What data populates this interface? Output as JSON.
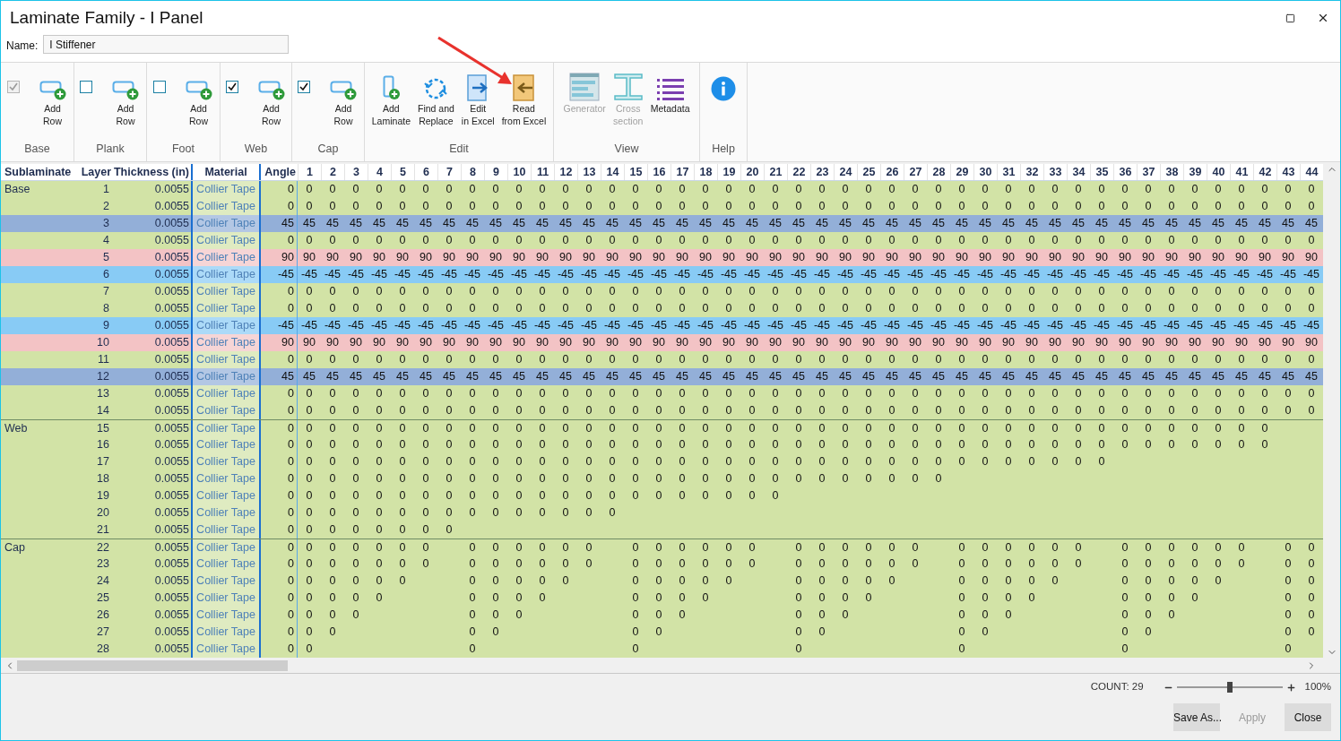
{
  "window": {
    "title": "Laminate Family - I Panel"
  },
  "name_field": {
    "label": "Name:",
    "value": "I Stiffener"
  },
  "ribbon": {
    "groups": [
      {
        "label": "Base",
        "items": [
          {
            "kind": "checkbox",
            "checked": true,
            "disabled": true
          },
          {
            "kind": "add-row",
            "lines": [
              "Add",
              "Row"
            ],
            "disabled": false
          }
        ]
      },
      {
        "label": "Plank",
        "items": [
          {
            "kind": "checkbox",
            "checked": false,
            "disabled": false
          },
          {
            "kind": "add-row",
            "lines": [
              "Add",
              "Row"
            ],
            "disabled": false
          }
        ]
      },
      {
        "label": "Foot",
        "items": [
          {
            "kind": "checkbox",
            "checked": false,
            "disabled": false
          },
          {
            "kind": "add-row",
            "lines": [
              "Add",
              "Row"
            ],
            "disabled": false
          }
        ]
      },
      {
        "label": "Web",
        "items": [
          {
            "kind": "checkbox",
            "checked": true,
            "disabled": false
          },
          {
            "kind": "add-row",
            "lines": [
              "Add",
              "Row"
            ],
            "disabled": false
          }
        ]
      },
      {
        "label": "Cap",
        "items": [
          {
            "kind": "checkbox",
            "checked": true,
            "disabled": false
          },
          {
            "kind": "add-row",
            "lines": [
              "Add",
              "Row"
            ],
            "disabled": false
          }
        ]
      },
      {
        "label": "Edit",
        "items": [
          {
            "kind": "add-laminate",
            "lines": [
              "Add",
              "Laminate"
            ],
            "disabled": false
          },
          {
            "kind": "find-replace",
            "lines": [
              "Find and",
              "Replace"
            ],
            "disabled": false
          },
          {
            "kind": "edit-excel",
            "lines": [
              "Edit",
              "in Excel"
            ],
            "disabled": false
          },
          {
            "kind": "read-excel",
            "lines": [
              "Read",
              "from Excel"
            ],
            "disabled": false
          }
        ]
      },
      {
        "label": "View",
        "items": [
          {
            "kind": "generator",
            "lines": [
              "Generator"
            ],
            "disabled": true
          },
          {
            "kind": "cross-section",
            "lines": [
              "Cross",
              "section"
            ],
            "disabled": true
          },
          {
            "kind": "metadata",
            "lines": [
              "Metadata"
            ],
            "disabled": false
          }
        ]
      },
      {
        "label": "Help",
        "items": [
          {
            "kind": "help"
          }
        ]
      }
    ]
  },
  "table": {
    "columns": [
      {
        "label": "Sublaminate",
        "selected": false
      },
      {
        "label": "Layer",
        "selected": false
      },
      {
        "label": "Thickness (in)",
        "selected": false
      },
      {
        "label": "Material",
        "selected": true
      },
      {
        "label": "Angle",
        "selected": false
      },
      {
        "label": "1",
        "selected": false
      },
      {
        "label": "2",
        "selected": false
      },
      {
        "label": "3",
        "selected": false
      },
      {
        "label": "4",
        "selected": false
      },
      {
        "label": "5",
        "selected": false
      },
      {
        "label": "6",
        "selected": false
      },
      {
        "label": "7",
        "selected": false
      },
      {
        "label": "8",
        "selected": false
      },
      {
        "label": "9",
        "selected": false
      },
      {
        "label": "10",
        "selected": false
      },
      {
        "label": "11",
        "selected": false
      },
      {
        "label": "12",
        "selected": false
      },
      {
        "label": "13",
        "selected": false
      },
      {
        "label": "14",
        "selected": false
      },
      {
        "label": "15",
        "selected": false
      },
      {
        "label": "16",
        "selected": false
      },
      {
        "label": "17",
        "selected": false
      },
      {
        "label": "18",
        "selected": false
      },
      {
        "label": "19",
        "selected": false
      },
      {
        "label": "20",
        "selected": false
      },
      {
        "label": "21",
        "selected": false
      },
      {
        "label": "22",
        "selected": false
      },
      {
        "label": "23",
        "selected": false
      },
      {
        "label": "24",
        "selected": false
      },
      {
        "label": "25",
        "selected": false
      },
      {
        "label": "26",
        "selected": false
      },
      {
        "label": "27",
        "selected": false
      },
      {
        "label": "28",
        "selected": false
      },
      {
        "label": "29",
        "selected": false
      },
      {
        "label": "30",
        "selected": false
      },
      {
        "label": "31",
        "selected": false
      },
      {
        "label": "32",
        "selected": false
      },
      {
        "label": "33",
        "selected": false
      },
      {
        "label": "34",
        "selected": false
      },
      {
        "label": "35",
        "selected": false
      },
      {
        "label": "36",
        "selected": false
      },
      {
        "label": "37",
        "selected": false
      },
      {
        "label": "38",
        "selected": false
      },
      {
        "label": "39",
        "selected": false
      },
      {
        "label": "40",
        "selected": false
      },
      {
        "label": "41",
        "selected": false
      },
      {
        "label": "42",
        "selected": false
      },
      {
        "label": "43",
        "selected": false
      },
      {
        "label": "44",
        "selected": false
      }
    ],
    "sublaminates": [
      {
        "name": "Base",
        "layers": [
          {
            "layer": "1",
            "thickness": "0.0055",
            "material": "Collier Tape",
            "angle": "0",
            "color": "#d2e3a6",
            "cells": [
              "0",
              "0",
              "0",
              "0",
              "0",
              "0",
              "0",
              "0",
              "0",
              "0",
              "0",
              "0",
              "0",
              "0",
              "0",
              "0",
              "0",
              "0",
              "0",
              "0",
              "0",
              "0",
              "0",
              "0",
              "0",
              "0",
              "0",
              "0",
              "0",
              "0",
              "0",
              "0",
              "0",
              "0",
              "0",
              "0",
              "0",
              "0",
              "0",
              "0",
              "0",
              "0",
              "0",
              "0"
            ]
          },
          {
            "layer": "2",
            "thickness": "0.0055",
            "material": "Collier Tape",
            "angle": "0",
            "color": "#d2e3a6",
            "cells": [
              "0",
              "0",
              "0",
              "0",
              "0",
              "0",
              "0",
              "0",
              "0",
              "0",
              "0",
              "0",
              "0",
              "0",
              "0",
              "0",
              "0",
              "0",
              "0",
              "0",
              "0",
              "0",
              "0",
              "0",
              "0",
              "0",
              "0",
              "0",
              "0",
              "0",
              "0",
              "0",
              "0",
              "0",
              "0",
              "0",
              "0",
              "0",
              "0",
              "0",
              "0",
              "0",
              "0",
              "0"
            ]
          },
          {
            "layer": "3",
            "thickness": "0.0055",
            "material": "Collier Tape",
            "angle": "45",
            "color": "#93afd8",
            "cells": [
              "45",
              "45",
              "45",
              "45",
              "45",
              "45",
              "45",
              "45",
              "45",
              "45",
              "45",
              "45",
              "45",
              "45",
              "45",
              "45",
              "45",
              "45",
              "45",
              "45",
              "45",
              "45",
              "45",
              "45",
              "45",
              "45",
              "45",
              "45",
              "45",
              "45",
              "45",
              "45",
              "45",
              "45",
              "45",
              "45",
              "45",
              "45",
              "45",
              "45",
              "45",
              "45",
              "45",
              "45"
            ]
          },
          {
            "layer": "4",
            "thickness": "0.0055",
            "material": "Collier Tape",
            "angle": "0",
            "color": "#d2e3a6",
            "cells": [
              "0",
              "0",
              "0",
              "0",
              "0",
              "0",
              "0",
              "0",
              "0",
              "0",
              "0",
              "0",
              "0",
              "0",
              "0",
              "0",
              "0",
              "0",
              "0",
              "0",
              "0",
              "0",
              "0",
              "0",
              "0",
              "0",
              "0",
              "0",
              "0",
              "0",
              "0",
              "0",
              "0",
              "0",
              "0",
              "0",
              "0",
              "0",
              "0",
              "0",
              "0",
              "0",
              "0",
              "0"
            ]
          },
          {
            "layer": "5",
            "thickness": "0.0055",
            "material": "Collier Tape",
            "angle": "90",
            "color": "#f3c3c5",
            "cells": [
              "90",
              "90",
              "90",
              "90",
              "90",
              "90",
              "90",
              "90",
              "90",
              "90",
              "90",
              "90",
              "90",
              "90",
              "90",
              "90",
              "90",
              "90",
              "90",
              "90",
              "90",
              "90",
              "90",
              "90",
              "90",
              "90",
              "90",
              "90",
              "90",
              "90",
              "90",
              "90",
              "90",
              "90",
              "90",
              "90",
              "90",
              "90",
              "90",
              "90",
              "90",
              "90",
              "90",
              "90"
            ]
          },
          {
            "layer": "6",
            "thickness": "0.0055",
            "material": "Collier Tape",
            "angle": "-45",
            "color": "#88cbf5",
            "cells": [
              "-45",
              "-45",
              "-45",
              "-45",
              "-45",
              "-45",
              "-45",
              "-45",
              "-45",
              "-45",
              "-45",
              "-45",
              "-45",
              "-45",
              "-45",
              "-45",
              "-45",
              "-45",
              "-45",
              "-45",
              "-45",
              "-45",
              "-45",
              "-45",
              "-45",
              "-45",
              "-45",
              "-45",
              "-45",
              "-45",
              "-45",
              "-45",
              "-45",
              "-45",
              "-45",
              "-45",
              "-45",
              "-45",
              "-45",
              "-45",
              "-45",
              "-45",
              "-45",
              "-45"
            ]
          },
          {
            "layer": "7",
            "thickness": "0.0055",
            "material": "Collier Tape",
            "angle": "0",
            "color": "#d2e3a6",
            "cells": [
              "0",
              "0",
              "0",
              "0",
              "0",
              "0",
              "0",
              "0",
              "0",
              "0",
              "0",
              "0",
              "0",
              "0",
              "0",
              "0",
              "0",
              "0",
              "0",
              "0",
              "0",
              "0",
              "0",
              "0",
              "0",
              "0",
              "0",
              "0",
              "0",
              "0",
              "0",
              "0",
              "0",
              "0",
              "0",
              "0",
              "0",
              "0",
              "0",
              "0",
              "0",
              "0",
              "0",
              "0"
            ]
          },
          {
            "layer": "8",
            "thickness": "0.0055",
            "material": "Collier Tape",
            "angle": "0",
            "color": "#d2e3a6",
            "cells": [
              "0",
              "0",
              "0",
              "0",
              "0",
              "0",
              "0",
              "0",
              "0",
              "0",
              "0",
              "0",
              "0",
              "0",
              "0",
              "0",
              "0",
              "0",
              "0",
              "0",
              "0",
              "0",
              "0",
              "0",
              "0",
              "0",
              "0",
              "0",
              "0",
              "0",
              "0",
              "0",
              "0",
              "0",
              "0",
              "0",
              "0",
              "0",
              "0",
              "0",
              "0",
              "0",
              "0",
              "0"
            ]
          },
          {
            "layer": "9",
            "thickness": "0.0055",
            "material": "Collier Tape",
            "angle": "-45",
            "color": "#88cbf5",
            "cells": [
              "-45",
              "-45",
              "-45",
              "-45",
              "-45",
              "-45",
              "-45",
              "-45",
              "-45",
              "-45",
              "-45",
              "-45",
              "-45",
              "-45",
              "-45",
              "-45",
              "-45",
              "-45",
              "-45",
              "-45",
              "-45",
              "-45",
              "-45",
              "-45",
              "-45",
              "-45",
              "-45",
              "-45",
              "-45",
              "-45",
              "-45",
              "-45",
              "-45",
              "-45",
              "-45",
              "-45",
              "-45",
              "-45",
              "-45",
              "-45",
              "-45",
              "-45",
              "-45",
              "-45"
            ]
          },
          {
            "layer": "10",
            "thickness": "0.0055",
            "material": "Collier Tape",
            "angle": "90",
            "color": "#f3c3c5",
            "cells": [
              "90",
              "90",
              "90",
              "90",
              "90",
              "90",
              "90",
              "90",
              "90",
              "90",
              "90",
              "90",
              "90",
              "90",
              "90",
              "90",
              "90",
              "90",
              "90",
              "90",
              "90",
              "90",
              "90",
              "90",
              "90",
              "90",
              "90",
              "90",
              "90",
              "90",
              "90",
              "90",
              "90",
              "90",
              "90",
              "90",
              "90",
              "90",
              "90",
              "90",
              "90",
              "90",
              "90",
              "90"
            ]
          },
          {
            "layer": "11",
            "thickness": "0.0055",
            "material": "Collier Tape",
            "angle": "0",
            "color": "#d2e3a6",
            "cells": [
              "0",
              "0",
              "0",
              "0",
              "0",
              "0",
              "0",
              "0",
              "0",
              "0",
              "0",
              "0",
              "0",
              "0",
              "0",
              "0",
              "0",
              "0",
              "0",
              "0",
              "0",
              "0",
              "0",
              "0",
              "0",
              "0",
              "0",
              "0",
              "0",
              "0",
              "0",
              "0",
              "0",
              "0",
              "0",
              "0",
              "0",
              "0",
              "0",
              "0",
              "0",
              "0",
              "0",
              "0"
            ]
          },
          {
            "layer": "12",
            "thickness": "0.0055",
            "material": "Collier Tape",
            "angle": "45",
            "color": "#93afd8",
            "cells": [
              "45",
              "45",
              "45",
              "45",
              "45",
              "45",
              "45",
              "45",
              "45",
              "45",
              "45",
              "45",
              "45",
              "45",
              "45",
              "45",
              "45",
              "45",
              "45",
              "45",
              "45",
              "45",
              "45",
              "45",
              "45",
              "45",
              "45",
              "45",
              "45",
              "45",
              "45",
              "45",
              "45",
              "45",
              "45",
              "45",
              "45",
              "45",
              "45",
              "45",
              "45",
              "45",
              "45",
              "45"
            ]
          },
          {
            "layer": "13",
            "thickness": "0.0055",
            "material": "Collier Tape",
            "angle": "0",
            "color": "#d2e3a6",
            "cells": [
              "0",
              "0",
              "0",
              "0",
              "0",
              "0",
              "0",
              "0",
              "0",
              "0",
              "0",
              "0",
              "0",
              "0",
              "0",
              "0",
              "0",
              "0",
              "0",
              "0",
              "0",
              "0",
              "0",
              "0",
              "0",
              "0",
              "0",
              "0",
              "0",
              "0",
              "0",
              "0",
              "0",
              "0",
              "0",
              "0",
              "0",
              "0",
              "0",
              "0",
              "0",
              "0",
              "0",
              "0"
            ]
          },
          {
            "layer": "14",
            "thickness": "0.0055",
            "material": "Collier Tape",
            "angle": "0",
            "color": "#d2e3a6",
            "cells": [
              "0",
              "0",
              "0",
              "0",
              "0",
              "0",
              "0",
              "0",
              "0",
              "0",
              "0",
              "0",
              "0",
              "0",
              "0",
              "0",
              "0",
              "0",
              "0",
              "0",
              "0",
              "0",
              "0",
              "0",
              "0",
              "0",
              "0",
              "0",
              "0",
              "0",
              "0",
              "0",
              "0",
              "0",
              "0",
              "0",
              "0",
              "0",
              "0",
              "0",
              "0",
              "0",
              "0",
              "0"
            ]
          }
        ]
      },
      {
        "name": "Web",
        "layers": [
          {
            "layer": "15",
            "thickness": "0.0055",
            "material": "Collier Tape",
            "angle": "0",
            "color": "#d2e3a6",
            "cells": [
              "0",
              "0",
              "0",
              "0",
              "0",
              "0",
              "0",
              "0",
              "0",
              "0",
              "0",
              "0",
              "0",
              "0",
              "0",
              "0",
              "0",
              "0",
              "0",
              "0",
              "0",
              "0",
              "0",
              "0",
              "0",
              "0",
              "0",
              "0",
              "0",
              "0",
              "0",
              "0",
              "0",
              "0",
              "0",
              "0",
              "0",
              "0",
              "0",
              "0",
              "0",
              "0"
            ]
          },
          {
            "layer": "16",
            "thickness": "0.0055",
            "material": "Collier Tape",
            "angle": "0",
            "color": "#d2e3a6",
            "cells": [
              "0",
              "0",
              "0",
              "0",
              "0",
              "0",
              "0",
              "0",
              "0",
              "0",
              "0",
              "0",
              "0",
              "0",
              "0",
              "0",
              "0",
              "0",
              "0",
              "0",
              "0",
              "0",
              "0",
              "0",
              "0",
              "0",
              "0",
              "0",
              "0",
              "0",
              "0",
              "0",
              "0",
              "0",
              "0",
              "0",
              "0",
              "0",
              "0",
              "0",
              "0",
              "0"
            ]
          },
          {
            "layer": "17",
            "thickness": "0.0055",
            "material": "Collier Tape",
            "angle": "0",
            "color": "#d2e3a6",
            "cells": [
              "0",
              "0",
              "0",
              "0",
              "0",
              "0",
              "0",
              "0",
              "0",
              "0",
              "0",
              "0",
              "0",
              "0",
              "0",
              "0",
              "0",
              "0",
              "0",
              "0",
              "0",
              "0",
              "0",
              "0",
              "0",
              "0",
              "0",
              "0",
              "0",
              "0",
              "0",
              "0",
              "0",
              "0",
              "0"
            ]
          },
          {
            "layer": "18",
            "thickness": "0.0055",
            "material": "Collier Tape",
            "angle": "0",
            "color": "#d2e3a6",
            "cells": [
              "0",
              "0",
              "0",
              "0",
              "0",
              "0",
              "0",
              "0",
              "0",
              "0",
              "0",
              "0",
              "0",
              "0",
              "0",
              "0",
              "0",
              "0",
              "0",
              "0",
              "0",
              "0",
              "0",
              "0",
              "0",
              "0",
              "0",
              "0"
            ]
          },
          {
            "layer": "19",
            "thickness": "0.0055",
            "material": "Collier Tape",
            "angle": "0",
            "color": "#d2e3a6",
            "cells": [
              "0",
              "0",
              "0",
              "0",
              "0",
              "0",
              "0",
              "0",
              "0",
              "0",
              "0",
              "0",
              "0",
              "0",
              "0",
              "0",
              "0",
              "0",
              "0",
              "0",
              "0"
            ]
          },
          {
            "layer": "20",
            "thickness": "0.0055",
            "material": "Collier Tape",
            "angle": "0",
            "color": "#d2e3a6",
            "cells": [
              "0",
              "0",
              "0",
              "0",
              "0",
              "0",
              "0",
              "0",
              "0",
              "0",
              "0",
              "0",
              "0",
              "0"
            ]
          },
          {
            "layer": "21",
            "thickness": "0.0055",
            "material": "Collier Tape",
            "angle": "0",
            "color": "#d2e3a6",
            "cells": [
              "0",
              "0",
              "0",
              "0",
              "0",
              "0",
              "0"
            ]
          }
        ]
      },
      {
        "name": "Cap",
        "layers": [
          {
            "layer": "22",
            "thickness": "0.0055",
            "material": "Collier Tape",
            "angle": "0",
            "color": "#d2e3a6",
            "cells": [
              "0",
              "0",
              "0",
              "0",
              "0",
              "0",
              null,
              "0",
              "0",
              "0",
              "0",
              "0",
              "0",
              null,
              "0",
              "0",
              "0",
              "0",
              "0",
              "0",
              null,
              "0",
              "0",
              "0",
              "0",
              "0",
              "0",
              null,
              "0",
              "0",
              "0",
              "0",
              "0",
              "0",
              null,
              "0",
              "0",
              "0",
              "0",
              "0",
              "0",
              null,
              "0",
              "0"
            ]
          },
          {
            "layer": "23",
            "thickness": "0.0055",
            "material": "Collier Tape",
            "angle": "0",
            "color": "#d2e3a6",
            "cells": [
              "0",
              "0",
              "0",
              "0",
              "0",
              "0",
              null,
              "0",
              "0",
              "0",
              "0",
              "0",
              "0",
              null,
              "0",
              "0",
              "0",
              "0",
              "0",
              "0",
              null,
              "0",
              "0",
              "0",
              "0",
              "0",
              "0",
              null,
              "0",
              "0",
              "0",
              "0",
              "0",
              "0",
              null,
              "0",
              "0",
              "0",
              "0",
              "0",
              "0",
              null,
              "0",
              "0"
            ]
          },
          {
            "layer": "24",
            "thickness": "0.0055",
            "material": "Collier Tape",
            "angle": "0",
            "color": "#d2e3a6",
            "cells": [
              "0",
              "0",
              "0",
              "0",
              "0",
              null,
              null,
              "0",
              "0",
              "0",
              "0",
              "0",
              null,
              null,
              "0",
              "0",
              "0",
              "0",
              "0",
              null,
              null,
              "0",
              "0",
              "0",
              "0",
              "0",
              null,
              null,
              "0",
              "0",
              "0",
              "0",
              "0",
              null,
              null,
              "0",
              "0",
              "0",
              "0",
              "0",
              null,
              null,
              "0",
              "0"
            ]
          },
          {
            "layer": "25",
            "thickness": "0.0055",
            "material": "Collier Tape",
            "angle": "0",
            "color": "#d2e3a6",
            "cells": [
              "0",
              "0",
              "0",
              "0",
              null,
              null,
              null,
              "0",
              "0",
              "0",
              "0",
              null,
              null,
              null,
              "0",
              "0",
              "0",
              "0",
              null,
              null,
              null,
              "0",
              "0",
              "0",
              "0",
              null,
              null,
              null,
              "0",
              "0",
              "0",
              "0",
              null,
              null,
              null,
              "0",
              "0",
              "0",
              "0",
              null,
              null,
              null,
              "0",
              "0"
            ]
          },
          {
            "layer": "26",
            "thickness": "0.0055",
            "material": "Collier Tape",
            "angle": "0",
            "color": "#d2e3a6",
            "cells": [
              "0",
              "0",
              "0",
              null,
              null,
              null,
              null,
              "0",
              "0",
              "0",
              null,
              null,
              null,
              null,
              "0",
              "0",
              "0",
              null,
              null,
              null,
              null,
              "0",
              "0",
              "0",
              null,
              null,
              null,
              null,
              "0",
              "0",
              "0",
              null,
              null,
              null,
              null,
              "0",
              "0",
              "0",
              null,
              null,
              null,
              null,
              "0",
              "0"
            ]
          },
          {
            "layer": "27",
            "thickness": "0.0055",
            "material": "Collier Tape",
            "angle": "0",
            "color": "#d2e3a6",
            "cells": [
              "0",
              "0",
              null,
              null,
              null,
              null,
              null,
              "0",
              "0",
              null,
              null,
              null,
              null,
              null,
              "0",
              "0",
              null,
              null,
              null,
              null,
              null,
              "0",
              "0",
              null,
              null,
              null,
              null,
              null,
              "0",
              "0",
              null,
              null,
              null,
              null,
              null,
              "0",
              "0",
              null,
              null,
              null,
              null,
              null,
              "0",
              "0"
            ]
          },
          {
            "layer": "28",
            "thickness": "0.0055",
            "material": "Collier Tape",
            "angle": "0",
            "color": "#d2e3a6",
            "cells": [
              "0",
              null,
              null,
              null,
              null,
              null,
              null,
              "0",
              null,
              null,
              null,
              null,
              null,
              null,
              "0",
              null,
              null,
              null,
              null,
              null,
              null,
              "0",
              null,
              null,
              null,
              null,
              null,
              null,
              "0",
              null,
              null,
              null,
              null,
              null,
              null,
              "0",
              null,
              null,
              null,
              null,
              null,
              null,
              "0"
            ]
          }
        ]
      }
    ]
  },
  "status_bar": {
    "count": "COUNT: 29",
    "zoom": {
      "level": 0.5,
      "reading": "100%"
    }
  },
  "buttons": [
    {
      "label": "Save As...",
      "disabled": false
    },
    {
      "label": "Apply",
      "disabled": true
    },
    {
      "label": "Close",
      "disabled": false
    }
  ]
}
